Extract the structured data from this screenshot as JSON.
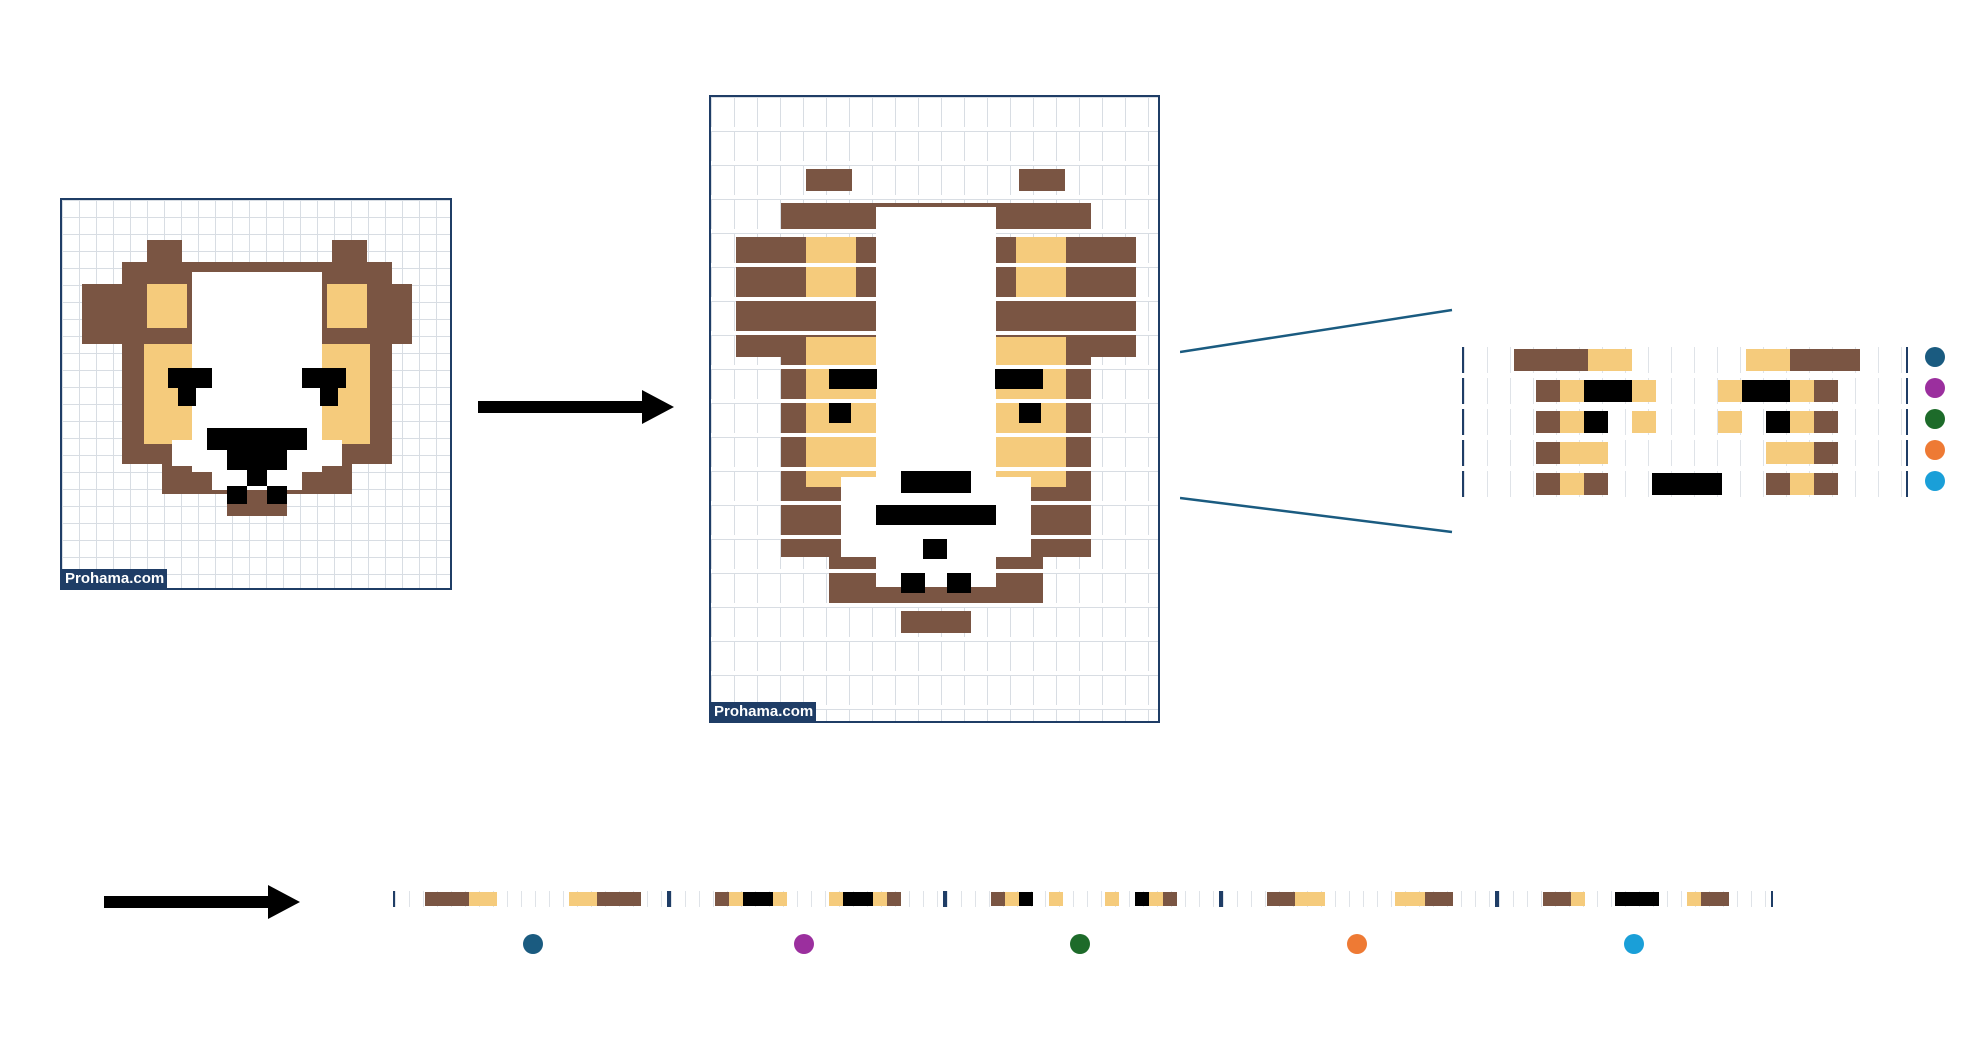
{
  "watermark_text": "Prohama.com",
  "icons": {
    "arrow_top": "right-arrow-icon",
    "arrow_bottom": "right-arrow-icon"
  },
  "colors": {
    "brown": "#7a5543",
    "tan": "#f5cb7c",
    "black": "#000000",
    "frame": "#1f3d66",
    "row_dots": [
      "#1a5b80",
      "#9b2f9e",
      "#1d6b2a",
      "#ee7a34",
      "#1a9fd8"
    ]
  }
}
